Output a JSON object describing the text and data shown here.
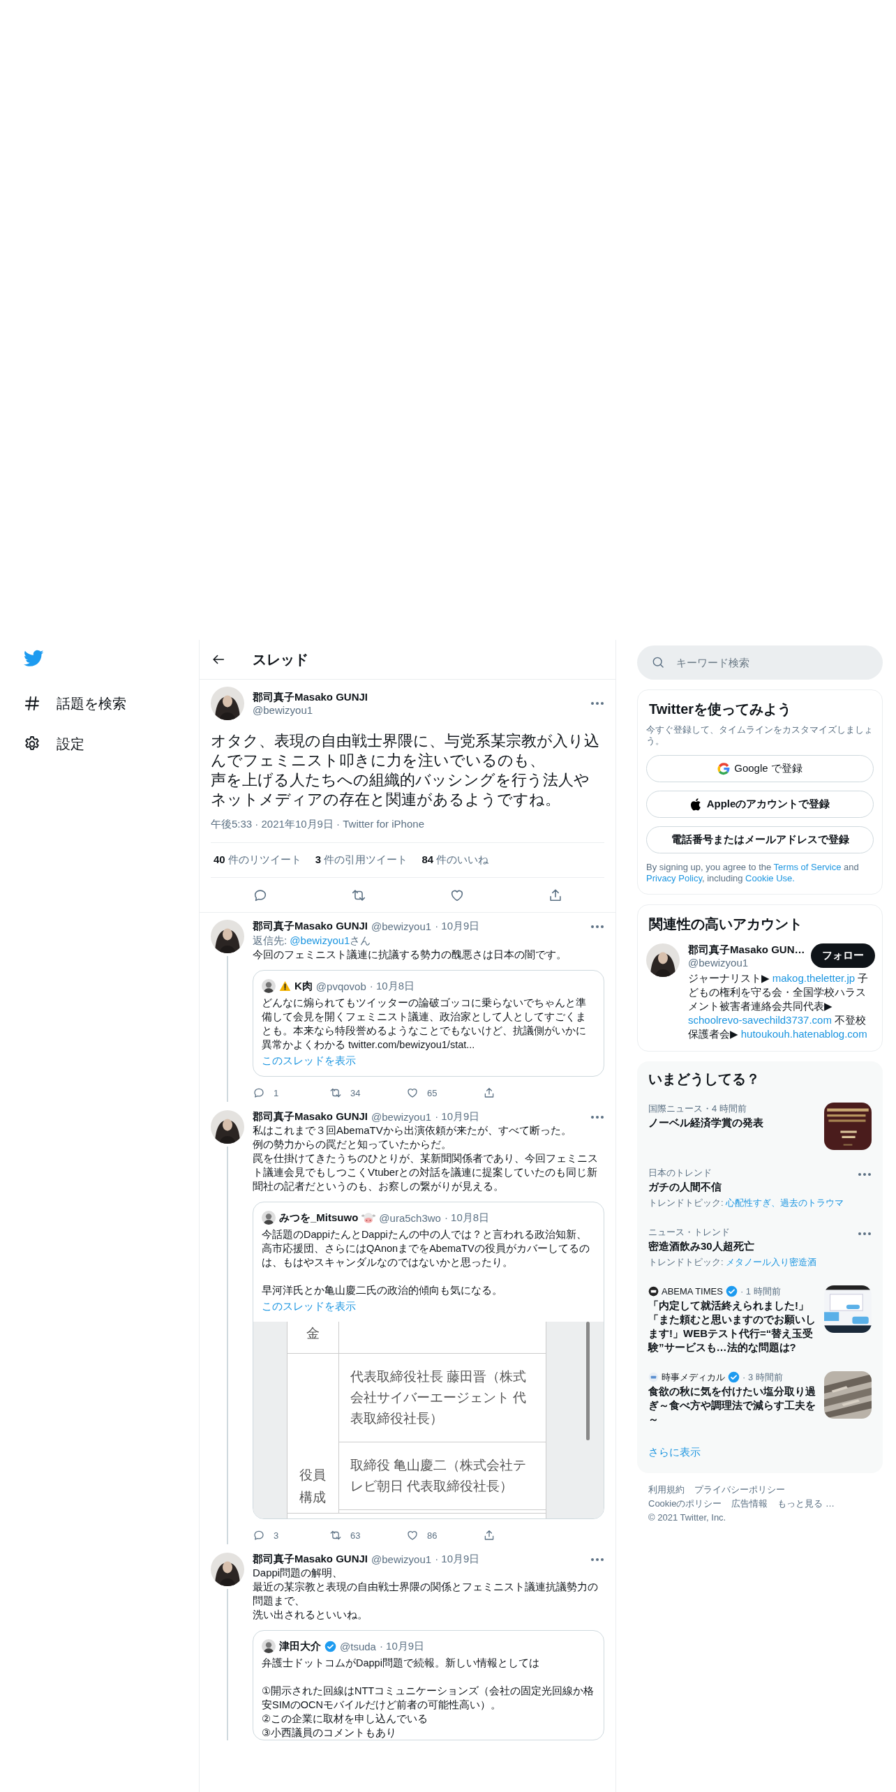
{
  "sidebar": {
    "items": [
      {
        "kind": "explore",
        "label": "話題を検索"
      },
      {
        "kind": "settings",
        "label": "設定"
      }
    ]
  },
  "thread": {
    "title": "スレッド",
    "main_tweet": {
      "name": "郡司真子Masako GUNJI",
      "handle": "@bewizyou1",
      "paragraphs": [
        [
          "オタク、表現の自由戦士界隈に、与党系某宗教が入り込んでフェミニスト叩きに力を注いでいるのも、",
          "声を上げる人たちへの組織的バッシングを行う法人やネットメディアの存在と関連があるようですね。"
        ]
      ],
      "meta": "午後5:33 · 2021年10月9日 · Twitter for iPhone",
      "stats": [
        {
          "count": "40",
          "label": " 件のリツイート"
        },
        {
          "count": "3",
          "label": " 件の引用ツイート"
        },
        {
          "count": "84",
          "label": " 件のいいね"
        }
      ],
      "actions": [
        {
          "kind": "reply"
        },
        {
          "kind": "retweet"
        },
        {
          "kind": "like"
        },
        {
          "kind": "share"
        }
      ]
    },
    "replies": [
      {
        "name": "郡司真子Masako GUNJI",
        "handle": "@bewizyou1",
        "date": "· 10月9日",
        "reply_to": {
          "prefix": "返信先: ",
          "handle": "@bewizyou1",
          "suffix": "さん"
        },
        "paragraphs": [
          [
            "今回のフェミニスト議連に抗議する勢力の醜悪さは日本の闇です。"
          ]
        ],
        "quote": {
          "kind": "warning",
          "name": "K肉",
          "verified": false,
          "handle": "@pvqovob",
          "date": "· 10月8日",
          "paragraphs": [
            [
              "どんなに煽られてもツイッターの論破ゴッコに乗らないでちゃんと準備して会見を開くフェミニスト議連、政治家として人としてすごくまとも。本来なら特段誉めるようなことでもないけど、抗議側がいかに異常かよくわかる twitter.com/bewizyou1/stat..."
            ]
          ],
          "show_thread": "このスレッドを表示"
        },
        "actions": [
          {
            "kind": "reply",
            "count": "1"
          },
          {
            "kind": "retweet",
            "count": "34"
          },
          {
            "kind": "like",
            "count": "65"
          },
          {
            "kind": "share"
          }
        ]
      },
      {
        "name": "郡司真子Masako GUNJI",
        "handle": "@bewizyou1",
        "date": "· 10月9日",
        "paragraphs": [
          [
            "私はこれまで３回AbemaTVから出演依頼が来たが、すべて断った。",
            "例の勢力からの罠だと知っていたからだ。",
            "罠を仕掛けてきたうちのひとりが、某新聞関係者であり、今回フェミニスト議連会見でもしつこくVtuberとの対話を議連に提案していたのも同じ新聞社の記者だというのも、お察しの繋がりが見える。"
          ]
        ],
        "quote": {
          "kind": "cow",
          "name": "みつを_Mitsuwo",
          "verified": false,
          "handle": "@ura5ch3wo",
          "date": "· 10月8日",
          "paragraphs": [
            [
              "今話題のDappiたんとDappiたんの中の人では？と言われる政治知新、高市応援団、さらにはQAnonまでをAbemaTVの役員がカバーしてるのは、もはやスキャンダルなのではないかと思ったり。"
            ],
            [
              "早河洋氏とか亀山慶二氏の政治的傾向も気になる。"
            ]
          ],
          "show_thread": "このスレッドを表示",
          "document": {
            "rows": [
              {
                "label": "金"
              },
              {
                "label": "役員構成",
                "cells": [
                  "代表取締役社長 藤田晋（株式会社サイバーエージェント 代表取締役社長）",
                  "取締役 亀山慶二（株式会社テレビ朝日 代表取締役社長）"
                ]
              }
            ]
          }
        },
        "actions": [
          {
            "kind": "reply",
            "count": "3"
          },
          {
            "kind": "retweet",
            "count": "63"
          },
          {
            "kind": "like",
            "count": "86"
          },
          {
            "kind": "share"
          }
        ]
      },
      {
        "name": "郡司真子Masako GUNJI",
        "handle": "@bewizyou1",
        "date": "· 10月9日",
        "paragraphs": [
          [
            "Dappi問題の解明、",
            "最近の某宗教と表現の自由戦士界隈の関係とフェミニスト議連抗議勢力の問題まで、",
            "洗い出されるといいね。"
          ]
        ],
        "quote": {
          "kind": "plain",
          "name": "津田大介",
          "verified": true,
          "handle": "@tsuda",
          "date": "· 10月9日",
          "paragraphs": [
            [
              "弁護士ドットコムがDappi問題で続報。新しい情報としては"
            ],
            [
              "①開示された回線はNTTコミュニケーションズ（会社の固定光回線か格安SIMのOCNモバイルだけど前者の可能性高い）。",
              "②この企業に取材を申し込んでいる",
              "③小西議員のコメントもあり"
            ]
          ]
        }
      }
    ]
  },
  "right": {
    "search": {
      "placeholder": "キーワード検索"
    },
    "signup": {
      "title": "Twitterを使ってみよう",
      "text": "今すぐ登録して、タイムラインをカスタマイズしましょう。",
      "buttons": [
        {
          "kind": "google",
          "label": "Google で登録"
        },
        {
          "kind": "apple",
          "label": "Appleのアカウントで登録"
        },
        {
          "kind": "plain",
          "label": "電話番号またはメールアドレスで登録"
        }
      ],
      "legal": [
        {
          "text": "By signing up, you agree to the ",
          "link": false
        },
        {
          "text": "Terms of Service",
          "link": true
        },
        {
          "text": " and ",
          "link": false
        },
        {
          "text": "Privacy Policy",
          "link": true
        },
        {
          "text": ", including ",
          "link": false
        },
        {
          "text": "Cookie Use.",
          "link": true
        }
      ]
    },
    "follow": {
      "title": "関連性の高いアカウント",
      "account": {
        "name": "郡司真子Masako GUN…",
        "handle": "@bewizyou1",
        "button": "フォロー",
        "bio": [
          {
            "text": "ジャーナリスト▶ ",
            "link": false
          },
          {
            "text": "makog.theletter.jp",
            "link": true
          },
          {
            "text": " 子どもの権利を守る会・全国学校ハラスメント被害者連絡会共同代表▶ ",
            "link": false
          },
          {
            "text": "schoolrevo-savechild3737.com",
            "link": true
          },
          {
            "text": " 不登校保護者会▶ ",
            "link": false
          },
          {
            "text": "hutoukouh.hatenablog.com",
            "link": true
          }
        ]
      }
    },
    "trends": {
      "title": "いまどうしてる？",
      "items": [
        {
          "kind": "news",
          "meta": "国際ニュース・4 時間前",
          "title": "ノーベル経済学賞の発表"
        },
        {
          "kind": "trend",
          "meta": "日本のトレンド",
          "title": "ガチの人間不信",
          "topic_label": "トレンドトピック: ",
          "topics": "心配性すぎ、過去のトラウマ"
        },
        {
          "kind": "trend",
          "meta": "ニュース・トレンド",
          "title": "密造酒飲み30人超死亡",
          "topic_label": "トレンドトピック: ",
          "topics": "メタノール入り密造酒"
        },
        {
          "kind": "news",
          "source": "ABEMA TIMES",
          "verified": true,
          "time": " · 1 時間前",
          "title": "「内定して就活終えられました!」「また頼むと思いますのでお願いします!」WEBテスト代行=“替え玉受験”サービスも…法的な問題は?"
        },
        {
          "kind": "news",
          "source": "時事メディカル",
          "verified": true,
          "time": " · 3 時間前",
          "title": "食欲の秋に気を付けたい塩分取り過ぎ～食べ方や調理法で減らす工夫を～"
        }
      ],
      "more": "さらに表示"
    },
    "footer": {
      "links": [
        "利用規約",
        "プライバシーポリシー",
        "Cookieのポリシー",
        "広告情報",
        "もっと見る …"
      ],
      "copyright": "© 2021 Twitter, Inc."
    }
  }
}
